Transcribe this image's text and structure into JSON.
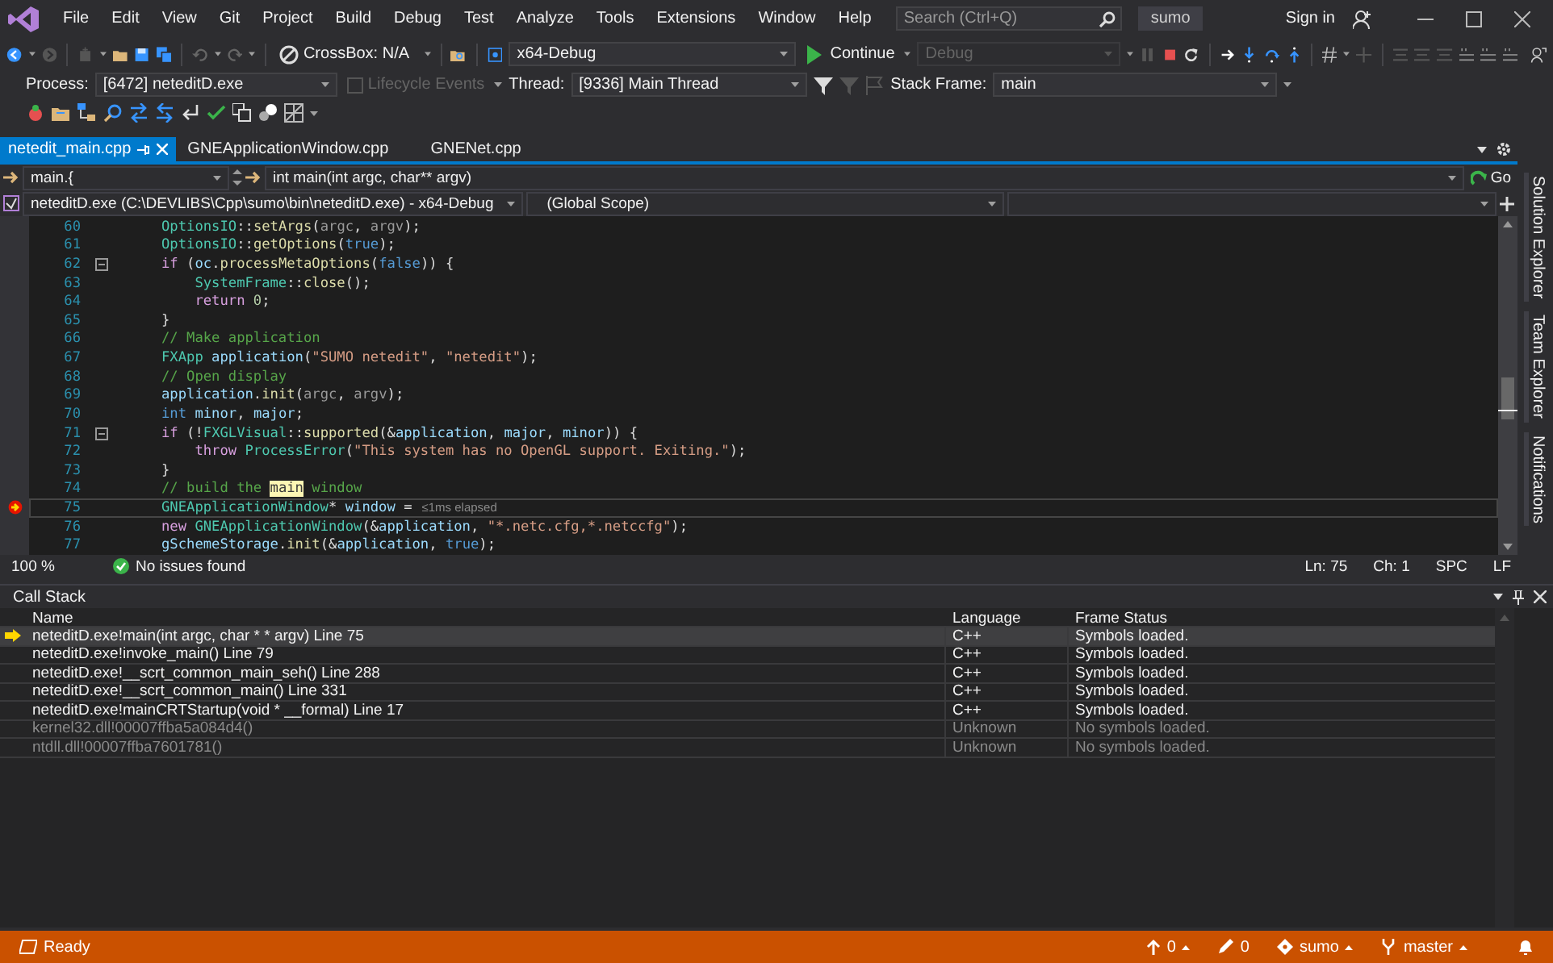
{
  "menu": [
    "File",
    "Edit",
    "View",
    "Git",
    "Project",
    "Build",
    "Debug",
    "Test",
    "Analyze",
    "Tools",
    "Extensions",
    "Window",
    "Help"
  ],
  "search": {
    "placeholder": "Search (Ctrl+Q)"
  },
  "solution_name": "sumo",
  "sign_in": "Sign in",
  "toolbar": {
    "crossbox": "CrossBox: N/A",
    "configuration": "x64-Debug",
    "continue": "Continue",
    "platform": "Debug",
    "platform_disabled": true
  },
  "debug_location": {
    "process_label": "Process:",
    "process": "[6472] neteditD.exe",
    "lifecycle": "Lifecycle Events",
    "lifecycle_disabled": true,
    "thread_label": "Thread:",
    "thread": "[9336] Main Thread",
    "stack_frame_label": "Stack Frame:",
    "stack_frame": "main"
  },
  "tabs": [
    {
      "label": "netedit_main.cpp",
      "selected": true
    },
    {
      "label": "GNEApplicationWindow.cpp",
      "selected": false
    },
    {
      "label": "GNENet.cpp",
      "selected": false
    }
  ],
  "navigation": {
    "scope": "main.{",
    "function": "int main(int argc, char** argv)",
    "go": "Go",
    "project": "neteditD.exe (C:\\DEVLIBS\\Cpp\\sumo\\bin\\neteditD.exe) - x64-Debug",
    "global_scope": "(Global Scope)"
  },
  "editor": {
    "lines": [
      {
        "number": "60",
        "fold": false,
        "breakpoint": false,
        "current": false,
        "tokens": [
          {
            "kind": "type",
            "text": "OptionsIO"
          },
          {
            "kind": "plain",
            "text": "::"
          },
          {
            "kind": "fn",
            "text": "setArgs"
          },
          {
            "kind": "plain",
            "text": "("
          },
          {
            "kind": "param",
            "text": "argc"
          },
          {
            "kind": "plain",
            "text": ", "
          },
          {
            "kind": "param",
            "text": "argv"
          },
          {
            "kind": "plain",
            "text": ");"
          }
        ]
      },
      {
        "number": "61",
        "fold": false,
        "breakpoint": false,
        "current": false,
        "tokens": [
          {
            "kind": "type",
            "text": "OptionsIO"
          },
          {
            "kind": "plain",
            "text": "::"
          },
          {
            "kind": "fn",
            "text": "getOptions"
          },
          {
            "kind": "plain",
            "text": "("
          },
          {
            "kind": "kw",
            "text": "true"
          },
          {
            "kind": "plain",
            "text": ");"
          }
        ]
      },
      {
        "number": "62",
        "fold": true,
        "breakpoint": false,
        "current": false,
        "tokens": [
          {
            "kind": "ctl",
            "text": "if"
          },
          {
            "kind": "plain",
            "text": " ("
          },
          {
            "kind": "var",
            "text": "oc"
          },
          {
            "kind": "plain",
            "text": "."
          },
          {
            "kind": "fn",
            "text": "processMetaOptions"
          },
          {
            "kind": "plain",
            "text": "("
          },
          {
            "kind": "kw",
            "text": "false"
          },
          {
            "kind": "plain",
            "text": ")) {"
          }
        ]
      },
      {
        "number": "63",
        "fold": false,
        "breakpoint": false,
        "current": false,
        "tokens": [
          {
            "kind": "type",
            "text": "    SystemFrame"
          },
          {
            "kind": "plain",
            "text": "::"
          },
          {
            "kind": "fn",
            "text": "close"
          },
          {
            "kind": "plain",
            "text": "();"
          }
        ]
      },
      {
        "number": "64",
        "fold": false,
        "breakpoint": false,
        "current": false,
        "tokens": [
          {
            "kind": "ctl",
            "text": "    return"
          },
          {
            "kind": "num",
            "text": " 0"
          },
          {
            "kind": "plain",
            "text": ";"
          }
        ]
      },
      {
        "number": "65",
        "fold": false,
        "breakpoint": false,
        "current": false,
        "tokens": [
          {
            "kind": "plain",
            "text": "}"
          }
        ]
      },
      {
        "number": "66",
        "fold": false,
        "breakpoint": false,
        "current": false,
        "tokens": [
          {
            "kind": "cmt",
            "text": "// Make application"
          }
        ]
      },
      {
        "number": "67",
        "fold": false,
        "breakpoint": false,
        "current": false,
        "tokens": [
          {
            "kind": "type",
            "text": "FXApp"
          },
          {
            "kind": "var",
            "text": " application"
          },
          {
            "kind": "plain",
            "text": "("
          },
          {
            "kind": "str",
            "text": "\"SUMO netedit\""
          },
          {
            "kind": "plain",
            "text": ", "
          },
          {
            "kind": "str",
            "text": "\"netedit\""
          },
          {
            "kind": "plain",
            "text": ");"
          }
        ]
      },
      {
        "number": "68",
        "fold": false,
        "breakpoint": false,
        "current": false,
        "tokens": [
          {
            "kind": "cmt",
            "text": "// Open display"
          }
        ]
      },
      {
        "number": "69",
        "fold": false,
        "breakpoint": false,
        "current": false,
        "tokens": [
          {
            "kind": "var",
            "text": "application"
          },
          {
            "kind": "plain",
            "text": "."
          },
          {
            "kind": "fn",
            "text": "init"
          },
          {
            "kind": "plain",
            "text": "("
          },
          {
            "kind": "param",
            "text": "argc"
          },
          {
            "kind": "plain",
            "text": ", "
          },
          {
            "kind": "param",
            "text": "argv"
          },
          {
            "kind": "plain",
            "text": ");"
          }
        ]
      },
      {
        "number": "70",
        "fold": false,
        "breakpoint": false,
        "current": false,
        "tokens": [
          {
            "kind": "kw",
            "text": "int"
          },
          {
            "kind": "var",
            "text": " minor"
          },
          {
            "kind": "plain",
            "text": ", "
          },
          {
            "kind": "var",
            "text": "major"
          },
          {
            "kind": "plain",
            "text": ";"
          }
        ]
      },
      {
        "number": "71",
        "fold": true,
        "breakpoint": false,
        "current": false,
        "tokens": [
          {
            "kind": "ctl",
            "text": "if"
          },
          {
            "kind": "plain",
            "text": " (!"
          },
          {
            "kind": "type",
            "text": "FXGLVisual"
          },
          {
            "kind": "plain",
            "text": "::"
          },
          {
            "kind": "fn",
            "text": "supported"
          },
          {
            "kind": "plain",
            "text": "(&"
          },
          {
            "kind": "var",
            "text": "application"
          },
          {
            "kind": "plain",
            "text": ", "
          },
          {
            "kind": "var",
            "text": "major"
          },
          {
            "kind": "plain",
            "text": ", "
          },
          {
            "kind": "var",
            "text": "minor"
          },
          {
            "kind": "plain",
            "text": ")) {"
          }
        ]
      },
      {
        "number": "72",
        "fold": false,
        "breakpoint": false,
        "current": false,
        "tokens": [
          {
            "kind": "ctl",
            "text": "    throw"
          },
          {
            "kind": "type",
            "text": " ProcessError"
          },
          {
            "kind": "plain",
            "text": "("
          },
          {
            "kind": "str",
            "text": "\"This system has no OpenGL support. Exiting.\""
          },
          {
            "kind": "plain",
            "text": ");"
          }
        ]
      },
      {
        "number": "73",
        "fold": false,
        "breakpoint": false,
        "current": false,
        "tokens": [
          {
            "kind": "plain",
            "text": "}"
          }
        ]
      },
      {
        "number": "74",
        "fold": false,
        "breakpoint": false,
        "current": false,
        "tokens": [
          {
            "kind": "cmt",
            "text": "// build the "
          },
          {
            "kind": "hl",
            "text": "main"
          },
          {
            "kind": "cmt",
            "text": " window"
          }
        ]
      },
      {
        "number": "75",
        "fold": false,
        "breakpoint": true,
        "current": true,
        "perf_tip": "≤1ms elapsed",
        "tokens": [
          {
            "kind": "type",
            "text": "GNEApplicationWindow"
          },
          {
            "kind": "plain",
            "text": "* "
          },
          {
            "kind": "var",
            "text": "window"
          },
          {
            "kind": "plain",
            "text": " ="
          }
        ]
      },
      {
        "number": "76",
        "fold": false,
        "breakpoint": false,
        "current": false,
        "tokens": [
          {
            "kind": "ctl",
            "text": "new"
          },
          {
            "kind": "type",
            "text": " GNEApplicationWindow"
          },
          {
            "kind": "plain",
            "text": "(&"
          },
          {
            "kind": "var",
            "text": "application"
          },
          {
            "kind": "plain",
            "text": ", "
          },
          {
            "kind": "str",
            "text": "\"*.netc.cfg,*.netccfg\""
          },
          {
            "kind": "plain",
            "text": ");"
          }
        ]
      },
      {
        "number": "77",
        "fold": false,
        "breakpoint": false,
        "current": false,
        "tokens": [
          {
            "kind": "var",
            "text": "gSchemeStorage"
          },
          {
            "kind": "plain",
            "text": "."
          },
          {
            "kind": "fn",
            "text": "init"
          },
          {
            "kind": "plain",
            "text": "(&"
          },
          {
            "kind": "var",
            "text": "application"
          },
          {
            "kind": "plain",
            "text": ", "
          },
          {
            "kind": "kw",
            "text": "true"
          },
          {
            "kind": "plain",
            "text": ");"
          }
        ]
      }
    ],
    "zoom": "100 %",
    "issues": "No issues found",
    "line": "Ln: 75",
    "column": "Ch: 1",
    "whitespace": "SPC",
    "line_ending": "LF"
  },
  "side_tabs": [
    "Solution Explorer",
    "Team Explorer",
    "Notifications"
  ],
  "call_stack": {
    "title": "Call Stack",
    "columns": [
      "Name",
      "Language",
      "Frame Status"
    ],
    "rows": [
      {
        "name": "neteditD.exe!main(int argc, char * * argv) Line 75",
        "language": "C++",
        "status": "Symbols loaded.",
        "selected": true,
        "current": true,
        "loaded": true
      },
      {
        "name": "neteditD.exe!invoke_main() Line 79",
        "language": "C++",
        "status": "Symbols loaded.",
        "selected": false,
        "current": false,
        "loaded": true
      },
      {
        "name": "neteditD.exe!__scrt_common_main_seh() Line 288",
        "language": "C++",
        "status": "Symbols loaded.",
        "selected": false,
        "current": false,
        "loaded": true
      },
      {
        "name": "neteditD.exe!__scrt_common_main() Line 331",
        "language": "C++",
        "status": "Symbols loaded.",
        "selected": false,
        "current": false,
        "loaded": true
      },
      {
        "name": "neteditD.exe!mainCRTStartup(void * __formal) Line 17",
        "language": "C++",
        "status": "Symbols loaded.",
        "selected": false,
        "current": false,
        "loaded": true
      },
      {
        "name": "kernel32.dll!00007ffba5a084d4()",
        "language": "Unknown",
        "status": "No symbols loaded.",
        "selected": false,
        "current": false,
        "loaded": false
      },
      {
        "name": "ntdll.dll!00007ffba7601781()",
        "language": "Unknown",
        "status": "No symbols loaded.",
        "selected": false,
        "current": false,
        "loaded": false
      }
    ]
  },
  "status_bar": {
    "state": "Ready",
    "pushes": "0",
    "changes": "0",
    "repository": "sumo",
    "branch": "master"
  }
}
